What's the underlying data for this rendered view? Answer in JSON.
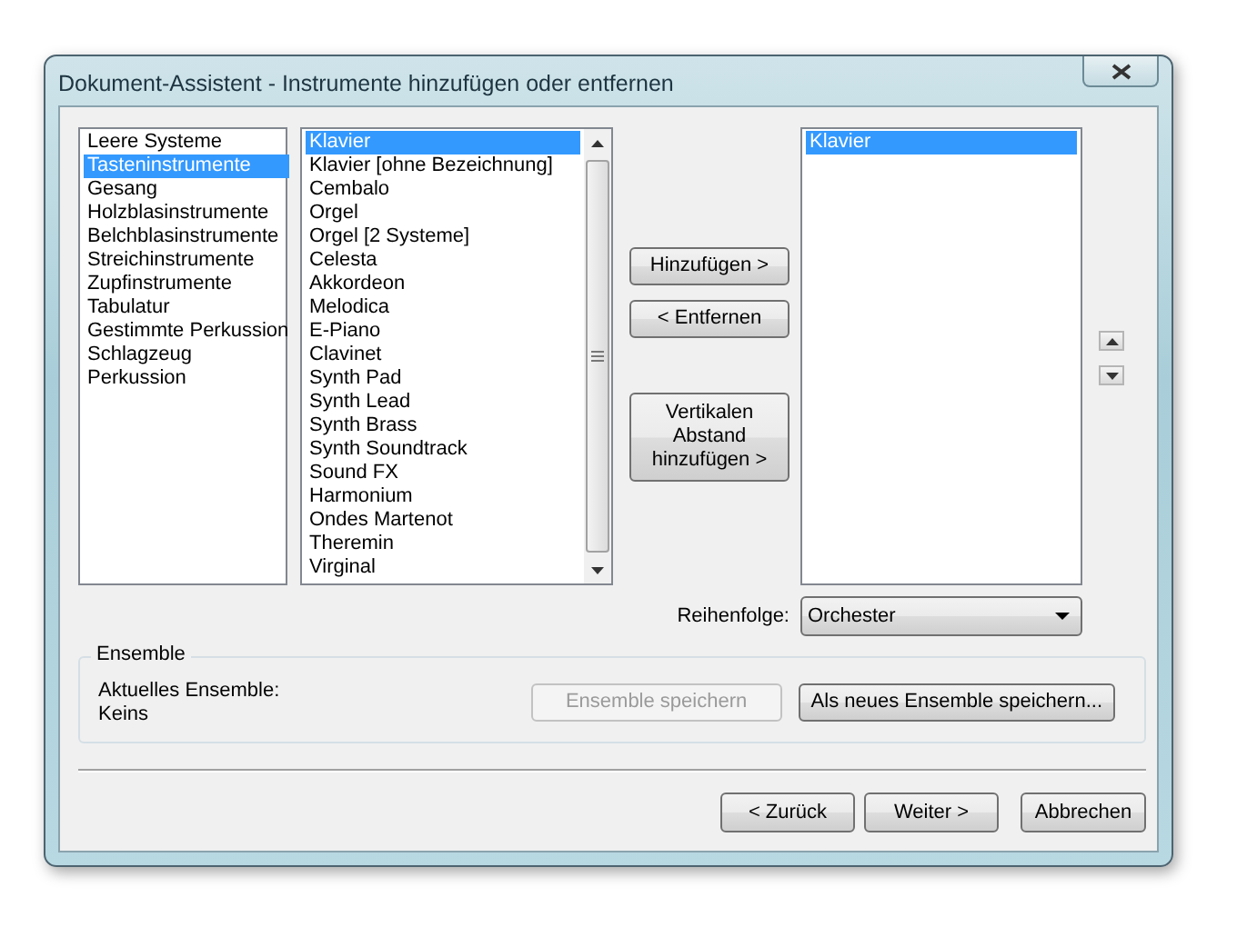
{
  "window": {
    "title": "Dokument-Assistent - Instrumente hinzufügen oder entfernen"
  },
  "categories": [
    {
      "label": "Leere Systeme",
      "selected": false
    },
    {
      "label": "Tasteninstrumente",
      "selected": true
    },
    {
      "label": "Gesang",
      "selected": false
    },
    {
      "label": "Holzblasinstrumente",
      "selected": false
    },
    {
      "label": "Belchblasinstrumente",
      "selected": false
    },
    {
      "label": "Streichinstrumente",
      "selected": false
    },
    {
      "label": "Zupfinstrumente",
      "selected": false
    },
    {
      "label": "Tabulatur",
      "selected": false
    },
    {
      "label": "Gestimmte Perkussion",
      "selected": false
    },
    {
      "label": "Schlagzeug",
      "selected": false
    },
    {
      "label": "Perkussion",
      "selected": false
    }
  ],
  "instruments": [
    {
      "label": "Klavier",
      "selected": true
    },
    {
      "label": "Klavier [ohne Bezeichnung]",
      "selected": false
    },
    {
      "label": "Cembalo",
      "selected": false
    },
    {
      "label": "Orgel",
      "selected": false
    },
    {
      "label": "Orgel [2 Systeme]",
      "selected": false
    },
    {
      "label": "Celesta",
      "selected": false
    },
    {
      "label": "Akkordeon",
      "selected": false
    },
    {
      "label": "Melodica",
      "selected": false
    },
    {
      "label": "E-Piano",
      "selected": false
    },
    {
      "label": "Clavinet",
      "selected": false
    },
    {
      "label": "Synth Pad",
      "selected": false
    },
    {
      "label": "Synth Lead",
      "selected": false
    },
    {
      "label": "Synth Brass",
      "selected": false
    },
    {
      "label": "Synth Soundtrack",
      "selected": false
    },
    {
      "label": "Sound FX",
      "selected": false
    },
    {
      "label": "Harmonium",
      "selected": false
    },
    {
      "label": "Ondes Martenot",
      "selected": false
    },
    {
      "label": "Theremin",
      "selected": false
    },
    {
      "label": "Virginal",
      "selected": false
    }
  ],
  "actions": [
    {
      "label": "Hinzufügen >",
      "kind": "short"
    },
    {
      "label": "< Entfernen",
      "kind": "short"
    },
    {
      "label": "Vertikalen Abstand hinzufügen >",
      "kind": "tall"
    }
  ],
  "score": [
    {
      "label": "Klavier",
      "selected": true
    }
  ],
  "order": {
    "label": "Reihenfolge:",
    "value": "Orchester"
  },
  "ensemble": {
    "title": "Ensemble",
    "current_label": "Aktuelles Ensemble:",
    "current_value": "Keins",
    "buttons": [
      {
        "label": "Ensemble speichern",
        "disabled": true
      },
      {
        "label": "Als neues Ensemble speichern...",
        "disabled": false
      }
    ]
  },
  "nav_buttons": [
    {
      "label": "< Zurück"
    },
    {
      "label": "Weiter >"
    },
    {
      "label": "Abbrechen"
    }
  ]
}
